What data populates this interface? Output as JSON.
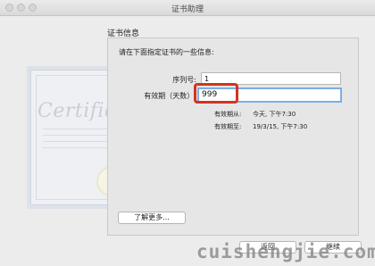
{
  "window": {
    "title": "证书助理"
  },
  "section": {
    "title": "证书信息",
    "prompt": "请在下面指定证书的一些信息:"
  },
  "form": {
    "serial_label": "序列号:",
    "serial_value": "1",
    "validity_label": "有效期（天数）:",
    "validity_value": "999",
    "valid_from_label": "有效期从:",
    "valid_from_value": "今天, 下午7:30",
    "valid_to_label": "有效期至:",
    "valid_to_value": "19/3/15, 下午7:30"
  },
  "buttons": {
    "learn_more": "了解更多...",
    "back": "返回",
    "continue": "继续"
  },
  "artwork": {
    "certificate_word": "Certificate"
  },
  "watermark": "cuishengjie.com",
  "colors": {
    "highlight": "#d2341f",
    "focus_ring": "#7aaeea"
  }
}
